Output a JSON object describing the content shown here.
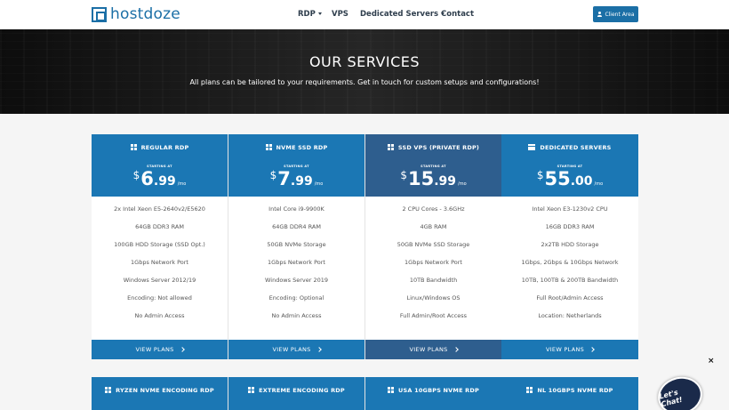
{
  "header": {
    "logo_text": "hostdoze",
    "nav": [
      {
        "label": "RDP",
        "dropdown": true
      },
      {
        "label": "VPS",
        "dropdown": false
      },
      {
        "label": "Dedicated Servers",
        "dropdown": true
      },
      {
        "label": "Contact",
        "dropdown": false
      }
    ],
    "client_area_label": "Client Area"
  },
  "hero": {
    "title": "OUR SERVICES",
    "subtitle": "All plans can be tailored to your requirements. Get in touch for custom setups and configurations!"
  },
  "plans": [
    {
      "name": "REGULAR RDP",
      "icon": "windows-icon",
      "starting_label": "STARTING AT",
      "currency": "$",
      "price_int": "6",
      "price_dec": ".99",
      "period": "/mo",
      "features": [
        "2x Intel Xeon E5-2640v2/E5620",
        "64GB DDR3 RAM",
        "100GB HDD Storage (SSD Opt.)",
        "1Gbps Network Port",
        "Windows Server 2012/19",
        "Encoding: Not allowed",
        "No Admin Access"
      ],
      "cta": "VIEW PLANS"
    },
    {
      "name": "NVME SSD RDP",
      "icon": "windows-icon",
      "starting_label": "STARTING AT",
      "currency": "$",
      "price_int": "7",
      "price_dec": ".99",
      "period": "/mo",
      "features": [
        "Intel Core i9-9900K",
        "64GB DDR4 RAM",
        "50GB NVMe Storage",
        "1Gbps Network Port",
        "Windows Server 2019",
        "Encoding: Optional",
        "No Admin Access"
      ],
      "cta": "VIEW PLANS"
    },
    {
      "name": "SSD VPS (PRIVATE RDP)",
      "icon": "windows-icon",
      "starting_label": "STARTING AT",
      "currency": "$",
      "price_int": "15",
      "price_dec": ".99",
      "period": "/mo",
      "features": [
        "2 CPU Cores - 3.6GHz",
        "4GB RAM",
        "50GB NVMe SSD Storage",
        "1Gbps Network Port",
        "10TB Bandwidth",
        "Linux/Windows OS",
        "Full Admin/Root Access"
      ],
      "cta": "VIEW PLANS"
    },
    {
      "name": "DEDICATED SERVERS",
      "icon": "server-icon",
      "starting_label": "STARTING AT",
      "currency": "$",
      "price_int": "55",
      "price_dec": ".00",
      "period": "/mo",
      "features": [
        "Intel Xeon E3-1230v2 CPU",
        "16GB DDR3 RAM",
        "2x2TB HDD Storage",
        "1Gbps, 2Gbps & 10Gbps Network",
        "10TB, 100TB & 200TB Bandwidth",
        "Full Root/Admin Access",
        "Location: Netherlands"
      ],
      "cta": "VIEW PLANS"
    }
  ],
  "plans_row2": [
    {
      "name": "RYZEN NVME ENCODING RDP",
      "icon": "windows-icon"
    },
    {
      "name": "EXTREME ENCODING RDP",
      "icon": "windows-icon"
    },
    {
      "name": "USA 10GBPS NVME RDP",
      "icon": "windows-icon"
    },
    {
      "name": "NL 10GBPS NVME RDP",
      "icon": "windows-icon"
    }
  ],
  "chat": {
    "close_label": "×",
    "badge_label": "Let's Chat!"
  },
  "colors": {
    "brand": "#1b6fa6",
    "card_head": "#1b77b4",
    "card_featured": "#2e5e8e"
  }
}
